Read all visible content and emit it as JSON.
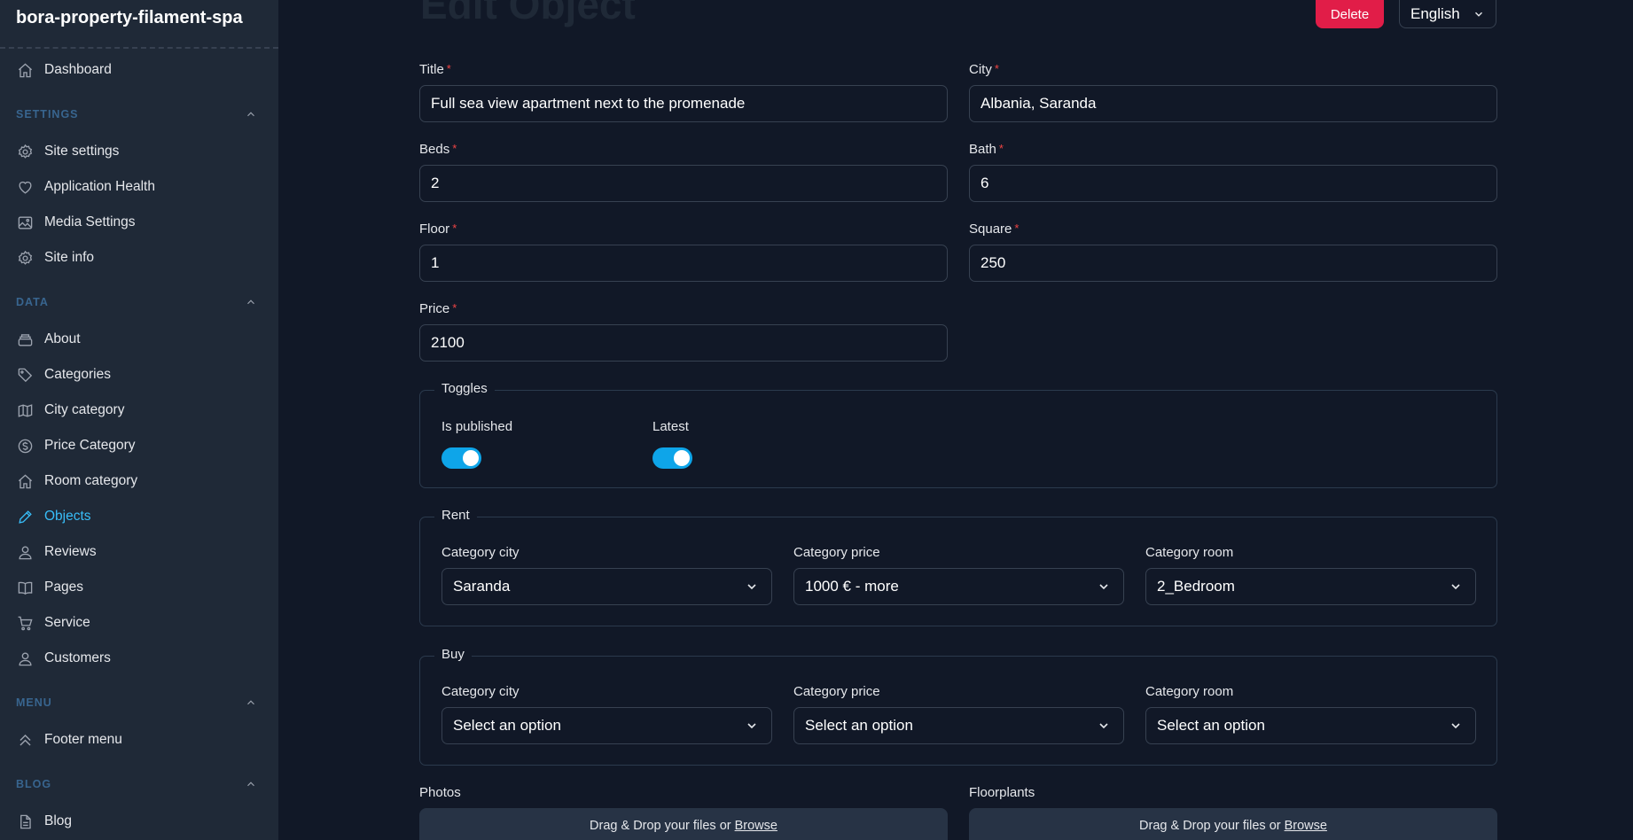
{
  "app": {
    "brand": "bora-property-filament-spa"
  },
  "sidebar": {
    "top": [
      {
        "label": "Dashboard",
        "icon": "home-icon"
      }
    ],
    "groups": [
      {
        "title": "SETTINGS",
        "items": [
          {
            "label": "Site settings",
            "icon": "gear-icon"
          },
          {
            "label": "Application Health",
            "icon": "heart-icon"
          },
          {
            "label": "Media Settings",
            "icon": "image-icon"
          },
          {
            "label": "Site info",
            "icon": "gear-icon"
          }
        ]
      },
      {
        "title": "DATA",
        "items": [
          {
            "label": "About",
            "icon": "stack-icon"
          },
          {
            "label": "Categories",
            "icon": "tag-icon"
          },
          {
            "label": "City category",
            "icon": "map-icon"
          },
          {
            "label": "Price Category",
            "icon": "dollar-icon"
          },
          {
            "label": "Room category",
            "icon": "home-icon"
          },
          {
            "label": "Objects",
            "icon": "pencil-icon",
            "active": true
          },
          {
            "label": "Reviews",
            "icon": "user-icon"
          },
          {
            "label": "Pages",
            "icon": "book-icon"
          },
          {
            "label": "Service",
            "icon": "cart-icon"
          },
          {
            "label": "Customers",
            "icon": "user-icon"
          }
        ]
      },
      {
        "title": "MENU",
        "items": [
          {
            "label": "Footer menu",
            "icon": "chevron-double-up-icon"
          }
        ]
      },
      {
        "title": "BLOG",
        "items": [
          {
            "label": "Blog",
            "icon": "document-icon"
          }
        ]
      }
    ]
  },
  "header": {
    "title": "Edit Object",
    "delete_label": "Delete",
    "language": "English"
  },
  "form": {
    "title": {
      "label": "Title",
      "value": "Full sea view apartment next to the promenade"
    },
    "city": {
      "label": "City",
      "value": "Albania, Saranda"
    },
    "beds": {
      "label": "Beds",
      "value": "2"
    },
    "bath": {
      "label": "Bath",
      "value": "6"
    },
    "floor": {
      "label": "Floor",
      "value": "1"
    },
    "square": {
      "label": "Square",
      "value": "250"
    },
    "price": {
      "label": "Price",
      "value": "2100"
    },
    "required_mark": "*"
  },
  "toggles": {
    "legend": "Toggles",
    "is_published": {
      "label": "Is published",
      "on": true
    },
    "latest": {
      "label": "Latest",
      "on": true
    }
  },
  "rent": {
    "legend": "Rent",
    "city": {
      "label": "Category city",
      "value": "Saranda"
    },
    "price": {
      "label": "Category price",
      "value": "1000 € - more"
    },
    "room": {
      "label": "Category room",
      "value": "2_Bedroom"
    }
  },
  "buy": {
    "legend": "Buy",
    "city": {
      "label": "Category city",
      "value": "Select an option"
    },
    "price": {
      "label": "Category price",
      "value": "Select an option"
    },
    "room": {
      "label": "Category room",
      "value": "Select an option"
    }
  },
  "uploads": {
    "photos": {
      "label": "Photos",
      "text": "Drag & Drop your files or",
      "browse": "Browse"
    },
    "floorplants": {
      "label": "Floorplants",
      "text": "Drag & Drop your files or",
      "browse": "Browse"
    }
  },
  "colors": {
    "accent": "#0ea5e9",
    "danger": "#e11d48",
    "sidebar_bg": "#1f2937",
    "page_bg": "#111827"
  }
}
